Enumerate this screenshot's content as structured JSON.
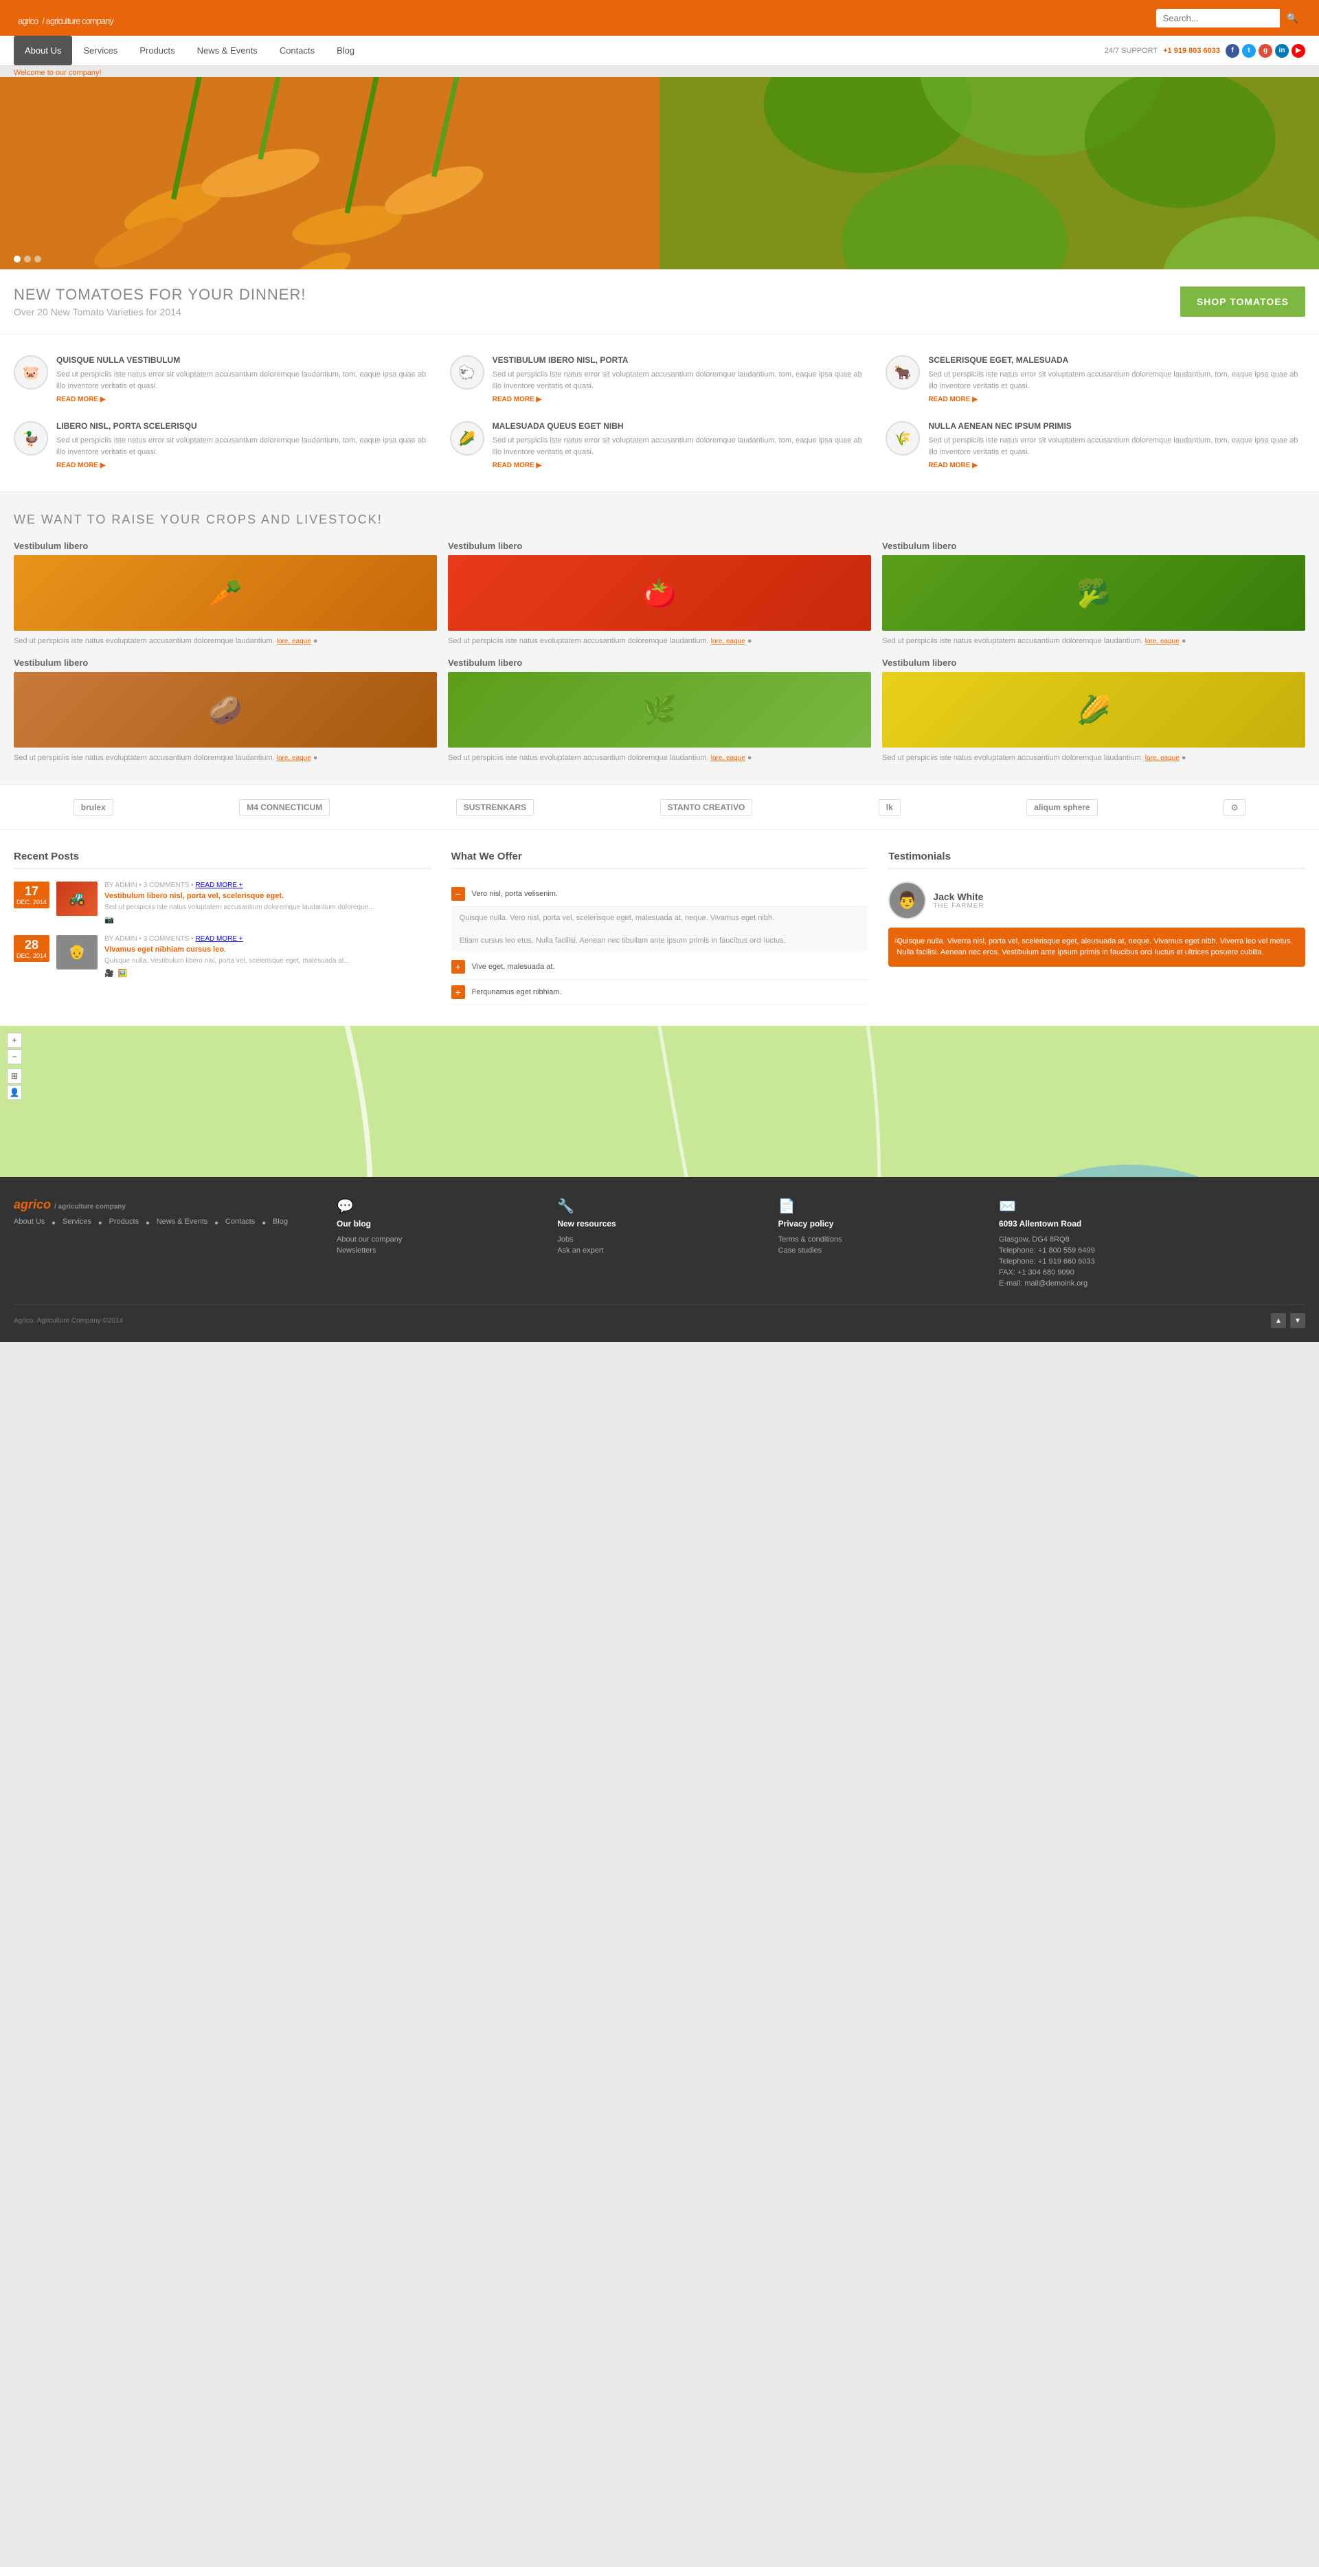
{
  "header": {
    "logo": "agrico",
    "logo_sub": "/ agriculture company",
    "search_placeholder": "Search..."
  },
  "nav": {
    "items": [
      {
        "label": "About Us",
        "active": true
      },
      {
        "label": "Services",
        "active": false
      },
      {
        "label": "Products",
        "active": false
      },
      {
        "label": "News & Events",
        "active": false
      },
      {
        "label": "Contacts",
        "active": false
      },
      {
        "label": "Blog",
        "active": false
      }
    ],
    "support_label": "24/7 SUPPORT",
    "phone": "+1 919 803 6033"
  },
  "hero": {
    "welcome": "Welcome to our company!"
  },
  "cta": {
    "headline": "NEW TOMATOES FOR YOUR DINNER!",
    "subtext": "Over 20 New Tomato Varieties for 2014",
    "button": "SHOP TOMATOES"
  },
  "features": [
    {
      "icon": "🐷",
      "title": "QUISQUE NULLA VESTIBULUM",
      "text": "Sed ut perspiciis iste natus error sit voluptatem accusantium doloremque laudantium, tom, eaque ipsa quae ab illo inventore veritatis et quasi.",
      "read_more": "READ MORE"
    },
    {
      "icon": "🐑",
      "title": "VESTIBULUM IBERO NISL, PORTA",
      "text": "Sed ut perspiciis iste natus error sit voluptatem accusantium doloremque laudantium, tom, eaque ipsa quae ab illo inventore veritatis et quasi.",
      "read_more": "READ MORE"
    },
    {
      "icon": "🐂",
      "title": "SCELERISQUE EGET, MALESUADA",
      "text": "Sed ut perspiciis iste natus error sit voluptatem accusantium doloremque laudantium, tom, eaque ipsa quae ab illo inventore veritatis et quasi.",
      "read_more": "READ MORE"
    },
    {
      "icon": "🦆",
      "title": "LIBERO NISL, PORTA SCELERISQU",
      "text": "Sed ut perspiciis iste natus error sit voluptatem accusantium doloremque laudantium, tom, eaque ipsa quae ab illo inventore veritatis et quasi.",
      "read_more": "READ MORE"
    },
    {
      "icon": "🌽",
      "title": "MALESUADA QUEUS EGET NIBH",
      "text": "Sed ut perspiciis iste natus error sit voluptatem accusantium doloremque laudantium, tom, eaque ipsa quae ab illo inventore veritatis et quasi.",
      "read_more": "READ MORE"
    },
    {
      "icon": "🌾",
      "title": "NULLA AENEAN NEC IPSUM PRIMIS",
      "text": "Sed ut perspiciis iste natus error sit voluptatem accusantium doloremque laudantium, tom, eaque ipsa quae ab illo inventore veritatis et quasi.",
      "read_more": "READ MORE"
    }
  ],
  "crops": {
    "headline": "WE WANT TO RAISE YOUR CROPS AND LIVESTOCK!",
    "items": [
      {
        "label": "Vestibulum libero",
        "type": "carrot",
        "emoji": "🥕",
        "bg": "#e8941a",
        "text": "Sed ut perspiciis iste natus evoluptatem accusantium doloremque laudantium.",
        "link": "lore, eaque"
      },
      {
        "label": "Vestibulum libero",
        "type": "tomato",
        "emoji": "🍅",
        "bg": "#e83a1a",
        "text": "Sed ut perspiciis iste natus evoluptatem accusantium doloremque laudantium.",
        "link": "lore, eaque"
      },
      {
        "label": "Vestibulum libero",
        "type": "artichoke",
        "emoji": "🥦",
        "bg": "#5a9e1a",
        "text": "Sed ut perspiciis iste natus evoluptatem accusantium doloremque laudantium.",
        "link": "lore, eaque"
      },
      {
        "label": "Vestibulum libero",
        "type": "sweet-potato",
        "emoji": "🥔",
        "bg": "#c87a3a",
        "text": "Sed ut perspiciis iste natus evoluptatem accusantium doloremque laudantium.",
        "link": "lore, eaque"
      },
      {
        "label": "Vestibulum libero",
        "type": "greens",
        "emoji": "🌿",
        "bg": "#5a9e1a",
        "text": "Sed ut perspiciis iste natus evoluptatem accusantium doloremque laudantium.",
        "link": "lore, eaque"
      },
      {
        "label": "Vestibulum libero",
        "type": "corn",
        "emoji": "🌽",
        "bg": "#e8d01a",
        "text": "Sed ut perspiciis iste natus evoluptatem accusantium doloremque laudantium.",
        "link": "lore, eaque"
      }
    ]
  },
  "brands": [
    "brulex",
    "M4 CONNECTICUM",
    "SUSTRENKARS",
    "STANTO CREATIVO",
    "lk",
    "aliqum sphere",
    "⊙"
  ],
  "recent_posts": {
    "title": "Recent Posts",
    "posts": [
      {
        "day": "17",
        "month": "DEC. 2014",
        "meta": "BY ADMIN • 3 COMMENTS • READ MORE +",
        "title": "Vestibulum libero nisl, porta vel, scelerisque eget.",
        "excerpt": "Sed ut perspiciis iste natus voluptatem accusantium doloremque laudantium doloreque...",
        "thumb_type": "tractor"
      },
      {
        "day": "28",
        "month": "DEC. 2014",
        "meta": "BY ADMIN • 3 COMMENTS • READ MORE +",
        "title": "Vivamus eget nibhiam cursus leo.",
        "excerpt": "Quisque nulla. Vestibulum libero nisl, porta vel, scelerisque eget, malesuada at...",
        "thumb_type": "person"
      }
    ]
  },
  "what_we_offer": {
    "title": "What We Offer",
    "items": [
      "Vero nisl, porta velisenim.",
      "Vivamus eget nibh.",
      "Nulla facilisi.",
      "Etiam cursus leo etus. Nulla facilisi. Aenean nec tibullam ante ipsum primis in faucibus orci luctus.",
      "Vive eget, malesuada at.",
      "Ferqunamus eget nibhiam."
    ]
  },
  "testimonials": {
    "title": "Testimonials",
    "person": {
      "name": "Jack White",
      "role": "THE FARMER"
    },
    "quote": "Quisque nulla. Viverra nisl, porta vel, scelerisque eget, aleusuada at, neque. Vivamus eget nibh. Viverra leo vel metus. Nulla facilisi. Aenean nec eros. Vestibulum ante ipsum primis in faucibus orci luctus et ultrices posuere cubilia."
  },
  "footer": {
    "logo": "agrico",
    "logo_sub": "/ agriculture company",
    "blog": {
      "title": "Our blog",
      "links": [
        "About our company",
        "Newsletters"
      ]
    },
    "resources": {
      "title": "New resources",
      "links": [
        "Jobs",
        "Ask an expert"
      ]
    },
    "legal": {
      "title": "Privacy policy",
      "links": [
        "Terms & conditions",
        "Case studies"
      ]
    },
    "contact": {
      "title": "6093 Allentown Road",
      "address": "Glasgow, DG4 8RQ8",
      "phone1": "Telephone: +1 800 559 6499",
      "phone2": "Telephone: +1 919 660 6033",
      "fax": "FAX: +1 304 680 9090",
      "email": "E-mail: mail@demoink.org"
    },
    "nav_links": [
      "About Us",
      "Services",
      "Products",
      "News & Events",
      "Contacts",
      "Blog"
    ],
    "copyright": "Agrico. Agriculture Company ©2014"
  }
}
